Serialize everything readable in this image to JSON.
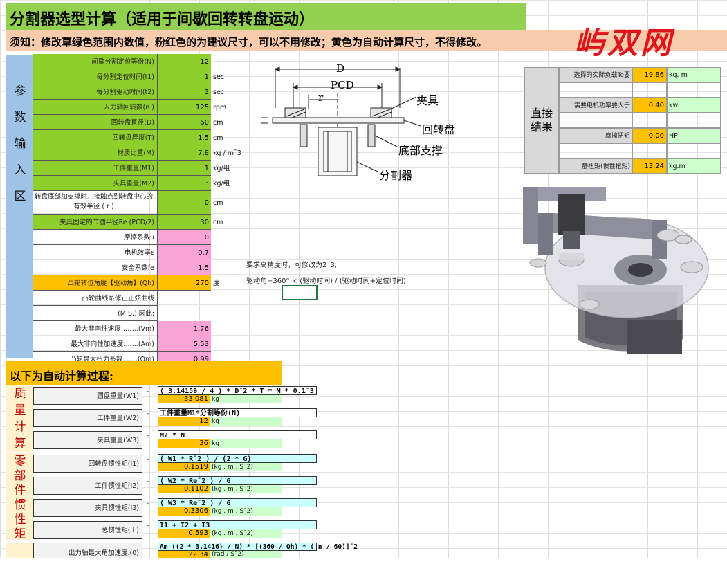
{
  "title": "分割器选型计算（适用于间歇回转转盘运动）",
  "notice": "须知：修改草绿色范围内数值，粉红色的为建议尺寸，可以不用修改；黄色为自动计算尺寸，不得修改。",
  "watermark": "屿双网",
  "param_section": {
    "label_chars": [
      "参",
      "数",
      "输",
      "入",
      "区"
    ],
    "rows": [
      {
        "label": "间歇分割定位等份(N)",
        "value": "12",
        "unit": ""
      },
      {
        "label": "每分割定位时间(t1)",
        "value": "1",
        "unit": "sec"
      },
      {
        "label": "每分割驱动时间(t2)",
        "value": "3",
        "unit": "sec"
      },
      {
        "label": "入力轴回转数(n )",
        "value": "125",
        "unit": "rpm"
      },
      {
        "label": "回转盘直径(D)",
        "value": "60",
        "unit": "cm"
      },
      {
        "label": "回转盘厚度(T)",
        "value": "1.5",
        "unit": "cm"
      },
      {
        "label": "材质比重(M)",
        "value": "7.8",
        "unit": "kg / m¯3"
      },
      {
        "label": "工件重量(M1)",
        "value": "1",
        "unit": "kg/组"
      },
      {
        "label": "夹具重量(M2)",
        "value": "3",
        "unit": "kg/组"
      },
      {
        "label": "转盘底部加支撑时，接触点到转盘中心的有效半径 ( r )",
        "value": "0",
        "unit": "cm"
      },
      {
        "label": "夹具固定的节圆半径Re (PCD/2)",
        "value": "30",
        "unit": "cm"
      },
      {
        "label": "摩擦系数u",
        "value": "0",
        "unit": ""
      },
      {
        "label": "电机效率ε",
        "value": "0.7",
        "unit": ""
      },
      {
        "label": "安全系数fe",
        "value": "1.5",
        "unit": ""
      },
      {
        "label": "凸轮转位角度【驱动角】(Qh)",
        "value": "270",
        "unit": "度"
      },
      {
        "label": "凸轮曲线系修正正弦曲线",
        "value": "",
        "unit": ""
      },
      {
        "label": "(M.S.),因此:",
        "value": "",
        "unit": ""
      },
      {
        "label": "最大非向性速度……..(Vm)",
        "value": "1.76",
        "unit": ""
      },
      {
        "label": "最大非向性加速度…....(Am)",
        "value": "5.53",
        "unit": ""
      },
      {
        "label": "凸轮最大扭力系数…....(Qm)",
        "value": "0.99",
        "unit": ""
      }
    ],
    "note1": "要求高精度时，可修改为2¯3;",
    "note2": "驱动角=360° × (驱动时间) / (驱动时间+定位时间)"
  },
  "diagram": {
    "D": "D",
    "PCD": "PCD",
    "r": "r",
    "jiaju": "夹具",
    "huizhuanpan": "回转盘",
    "dibuzhicheng": "底部支撑",
    "fengeqi": "分割器"
  },
  "result": {
    "label": "直接结果",
    "rows": [
      {
        "label": "选择的实际负载Te要",
        "value": "19.86",
        "unit": "kg. m"
      },
      {
        "label": "",
        "value": "",
        "unit": ""
      },
      {
        "label": "需要电机功率要大于",
        "value": "0.40",
        "unit": "kw"
      },
      {
        "label": "",
        "value": "",
        "unit": ""
      },
      {
        "label": "摩擦扭矩",
        "value": "0.00",
        "unit": "HP"
      },
      {
        "label": "",
        "value": "",
        "unit": ""
      },
      {
        "label": "静扭矩(惯性扭矩)",
        "value": "13.24",
        "unit": "kg.m"
      }
    ]
  },
  "auto_title": "以下为自动计算过程:",
  "mass_section": {
    "label_chars": [
      "质",
      "量",
      "计",
      "算"
    ],
    "rows": [
      {
        "label": "圆盘重量(W1)",
        "formula": "( 3.14159 / 4 ) * D¯2 * T * M * 0.1¯3",
        "value": "33.081",
        "unit": "kg"
      },
      {
        "label": "工件重量(W2)",
        "formula": "工件重量M1*分割等份(N)",
        "value": "12",
        "unit": "kg"
      },
      {
        "label": "夹具重量(W3)",
        "formula": "M2 * N",
        "value": "36",
        "unit": "kg"
      }
    ]
  },
  "inertia_section": {
    "label_chars": [
      "零",
      "部",
      "件",
      "惯",
      "性",
      "矩"
    ],
    "rows": [
      {
        "label": "回转盘惯性矩(I1)",
        "formula": "( W1 * R¯2 ) / (2 * G)",
        "value": "0.1519",
        "unit": "(kg . m . S¯2)"
      },
      {
        "label": "工件惯性矩(I2)",
        "formula": "( W2 * Re¯2 ) / G",
        "value": "0.1102",
        "unit": "(kg . m . S¯2)"
      },
      {
        "label": "夹具惯性矩(I3)",
        "formula": "( W3 * Re¯2 ) / G",
        "value": "0.3306",
        "unit": "(kg . m . S¯2)"
      },
      {
        "label": "总惯性矩( I )",
        "formula": "I1 + I2 + I3",
        "value": "0.593",
        "unit": "(kg . m . S¯2)"
      }
    ]
  },
  "last_row": {
    "label": "出力轴最大角加速度.(0)",
    "formula": "Am ((2 * 3.1416) / N) * [(360 / Qh) * ( n / 60)]¯2",
    "value": "22.34",
    "unit": "(rad / S¯2)"
  }
}
